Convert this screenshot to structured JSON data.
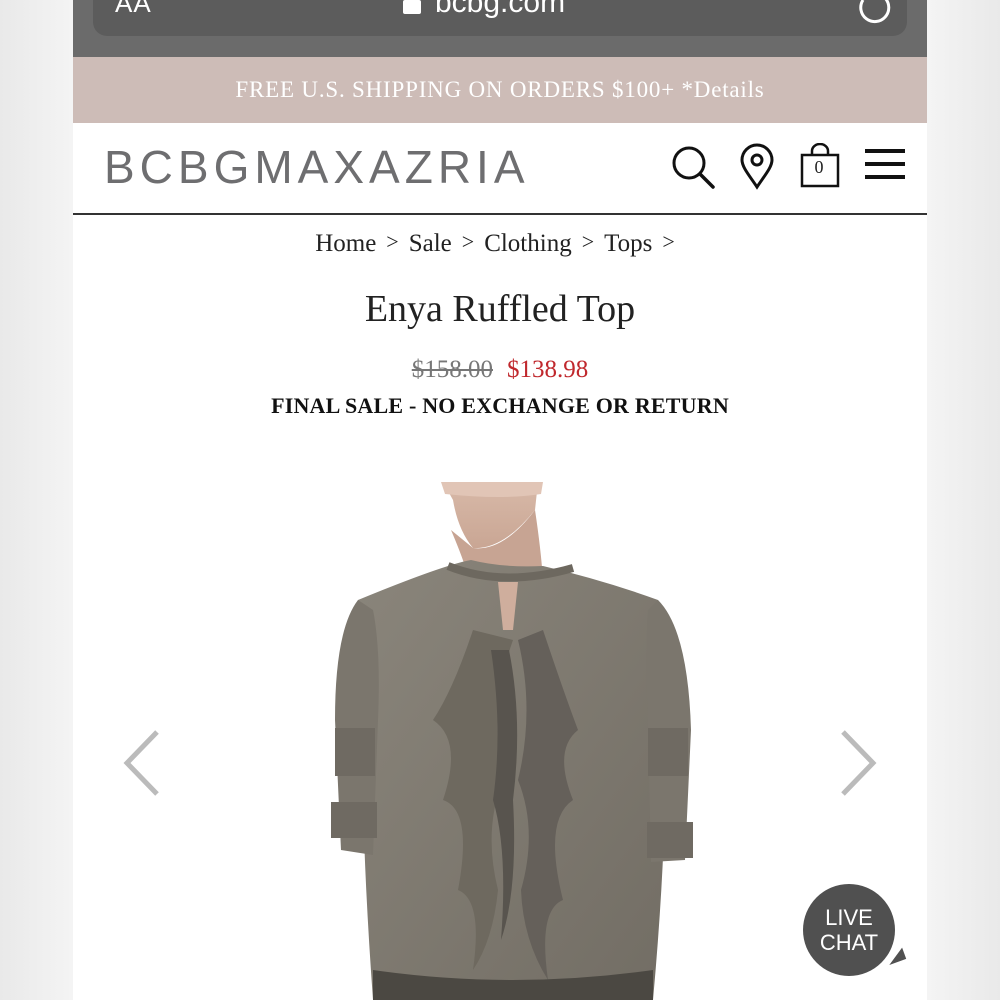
{
  "browser": {
    "text_size_label": "AA",
    "url": "bcbg.com"
  },
  "promo": {
    "text": "FREE U.S. SHIPPING ON ORDERS $100+ *Details"
  },
  "header": {
    "logo": "BCBGMAXAZRIA",
    "cart_count": "0",
    "icons": [
      "search-icon",
      "location-pin-icon",
      "shopping-bag-icon",
      "hamburger-menu-icon"
    ]
  },
  "breadcrumb": {
    "items": [
      "Home",
      "Sale",
      "Clothing",
      "Tops"
    ],
    "separator": ">"
  },
  "product": {
    "title": "Enya Ruffled Top",
    "original_price": "$158.00",
    "sale_price": "$138.98",
    "notice": "FINAL SALE - NO EXCHANGE OR RETURN"
  },
  "live_chat": {
    "line1": "LIVE",
    "line2": "CHAT"
  },
  "colors": {
    "promo_bg": "#cdbcb7",
    "browser_bar": "#6b6b6b",
    "sale_price": "#c0282d",
    "logo": "#6e6e70",
    "product_blouse": "#817b71"
  }
}
